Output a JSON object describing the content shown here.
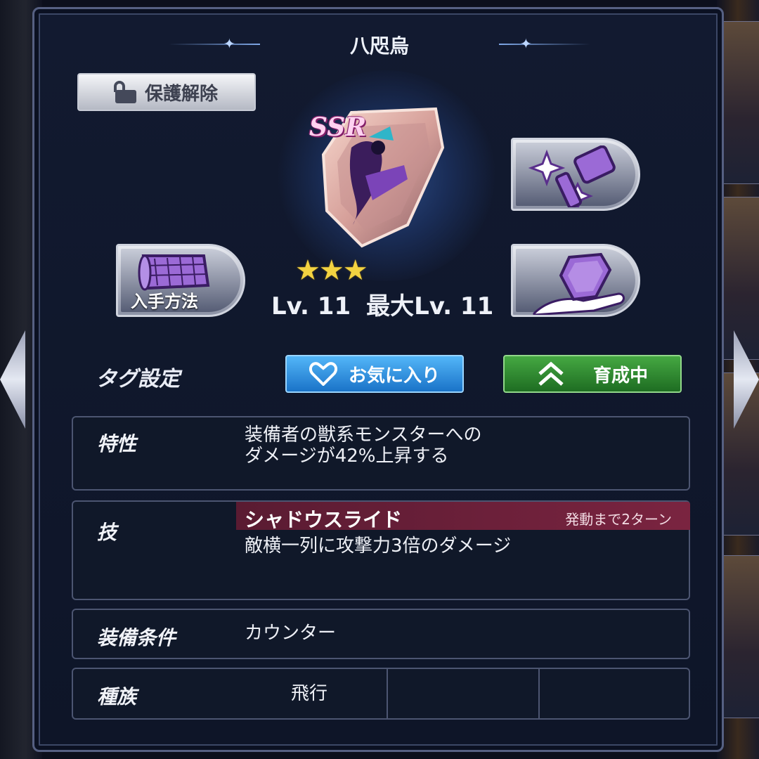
{
  "title": "八咫烏",
  "protect_button": {
    "label": "保護解除",
    "icon": "unlock-icon"
  },
  "item": {
    "rarity": "SSR",
    "stars": "★★★",
    "star_count": 3,
    "level_label": "Lv. 11",
    "max_level_label": "最大Lv. 11"
  },
  "buttons": {
    "acquire_label": "入手方法",
    "enhance_icon": "hammer-sparkle-icon",
    "limit_break_icon": "shield-hand-icon"
  },
  "tags": {
    "label": "タグ設定",
    "favorite_label": "お気に入り",
    "growing_label": "育成中"
  },
  "trait": {
    "label": "特性",
    "text_line1": "装備者の獣系モンスターへの",
    "text_line2": "ダメージが42%上昇する"
  },
  "skill": {
    "label": "技",
    "name": "シャドウスライド",
    "cooldown": "発動まで2ターン",
    "description": "敵横一列に攻撃力3倍のダメージ"
  },
  "equip_condition": {
    "label": "装備条件",
    "value": "カウンター"
  },
  "race": {
    "label": "種族",
    "value1": "飛行",
    "value2": "",
    "value3": ""
  },
  "colors": {
    "favorite_blue": "#2a8de0",
    "growing_green": "#2f8a30",
    "skill_bar": "#6e2140",
    "panel_bg": "#101829"
  }
}
